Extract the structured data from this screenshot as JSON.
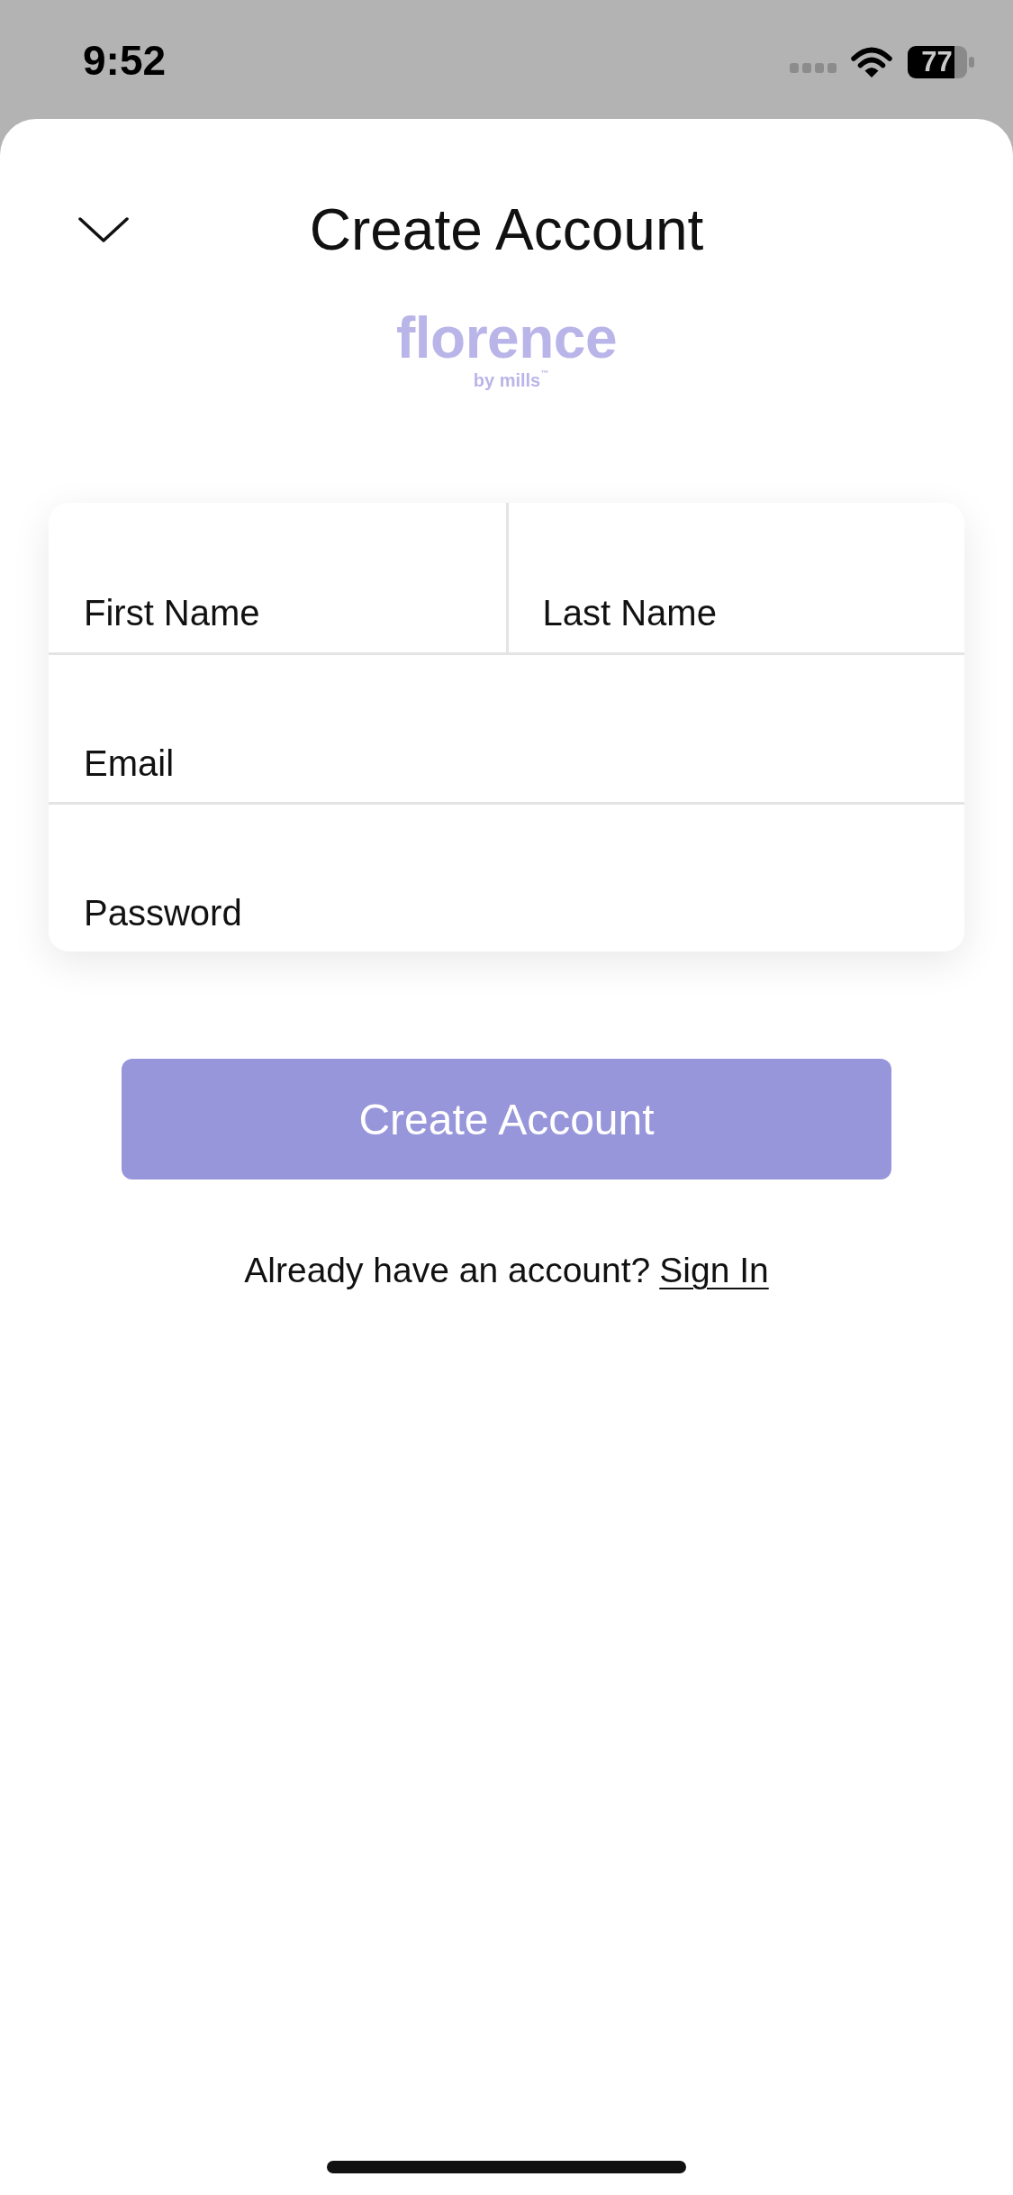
{
  "status_bar": {
    "time": "9:52",
    "battery": "77"
  },
  "header": {
    "title": "Create Account"
  },
  "logo": {
    "wordmark": "florence",
    "tagline": "by mills$^{™}$"
  },
  "form": {
    "rows": [
      {
        "fields": [
          {
            "placeholder": "First Name"
          },
          {
            "placeholder": "Last Name"
          }
        ]
      },
      {
        "fields": [
          {
            "placeholder": "Email"
          }
        ]
      },
      {
        "fields": [
          {
            "placeholder": "Password"
          }
        ]
      }
    ]
  },
  "submit_button": {
    "label": "Create Account"
  },
  "footer": {
    "prompt": "Already have an account?",
    "link": "Sign In"
  }
}
